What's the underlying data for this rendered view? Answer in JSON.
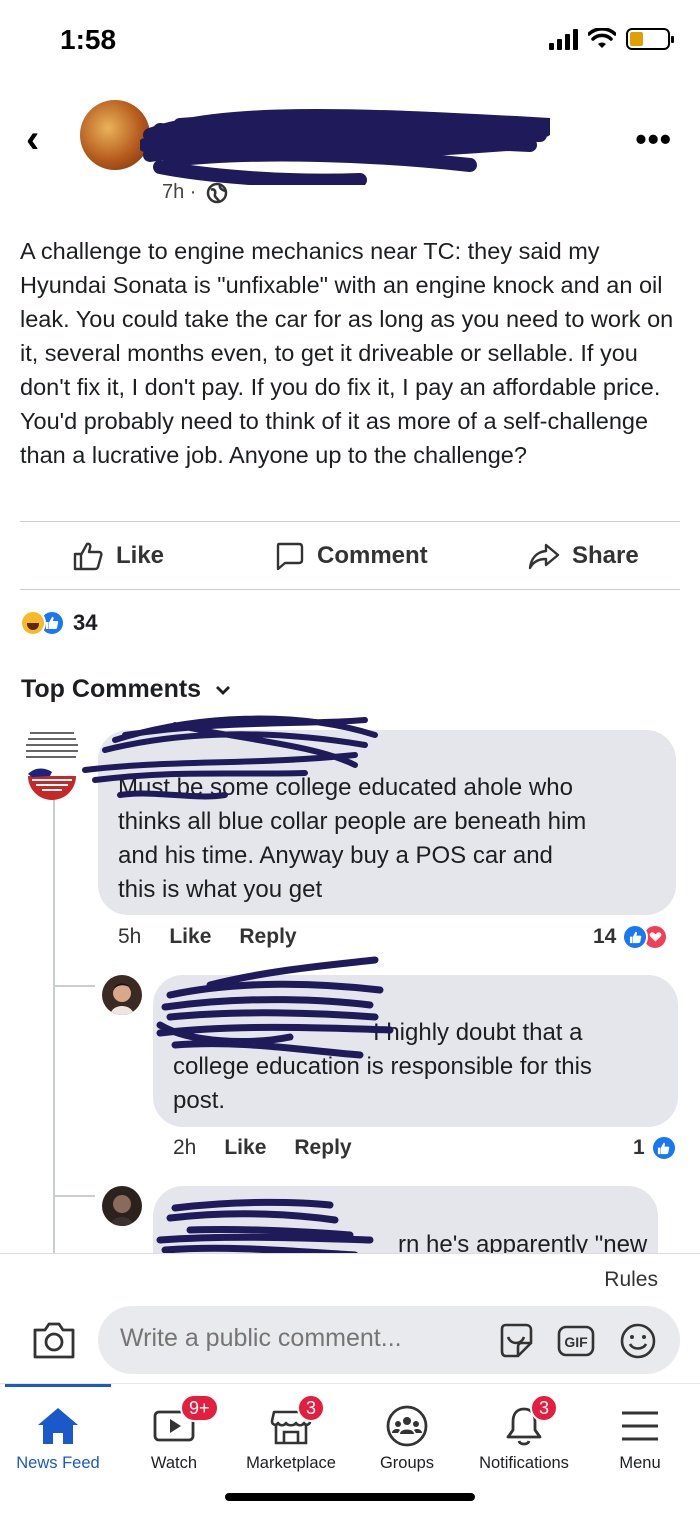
{
  "status_bar": {
    "time": "1:58",
    "battery_level": 0.35
  },
  "post": {
    "time": "7h ·",
    "body": "A challenge to engine mechanics near TC: they said my Hyundai Sonata is \"unfixable\" with an engine knock and an oil leak. You could take the car for as long as you need to work on it, several months even, to get it driveable or sellable. If you don't fix it, I don't pay. If you do fix it, I pay an affordable price. You'd probably need to think of it as more of a self-challenge than a lucrative job. Anyone up to the challenge?",
    "actions": {
      "like": "Like",
      "comment": "Comment",
      "share": "Share"
    },
    "reaction_count": "34"
  },
  "top_comments_label": "Top Comments",
  "comments": [
    {
      "text_lines": [
        "Must be some college educated ahole who",
        "thinks all blue collar people are beneath him",
        "and his time. Anyway buy a POS car and",
        "this is what you get"
      ],
      "time": "5h",
      "like": "Like",
      "reply": "Reply",
      "reactions": "14"
    },
    {
      "text_lines": [
        "I highly doubt that a",
        "college education is responsible for this",
        "post."
      ],
      "time": "2h",
      "like": "Like",
      "reply": "Reply",
      "reactions": "1"
    },
    {
      "text_lines": [
        "rn he's apparently \"new"
      ]
    }
  ],
  "composer": {
    "rules": "Rules",
    "placeholder": "Write a public comment..."
  },
  "nav": [
    {
      "label": "News Feed",
      "icon": "home-icon",
      "badge": ""
    },
    {
      "label": "Watch",
      "icon": "video-icon",
      "badge": "9+"
    },
    {
      "label": "Marketplace",
      "icon": "shop-icon",
      "badge": "3"
    },
    {
      "label": "Groups",
      "icon": "groups-icon",
      "badge": ""
    },
    {
      "label": "Notifications",
      "icon": "bell-icon",
      "badge": "3"
    },
    {
      "label": "Menu",
      "icon": "menu-icon",
      "badge": ""
    }
  ],
  "colors": {
    "like_blue": "#1877f2",
    "scribble": "#1f1a5a",
    "badge_red": "#e41e3f",
    "active_nav": "#1b58c9"
  }
}
